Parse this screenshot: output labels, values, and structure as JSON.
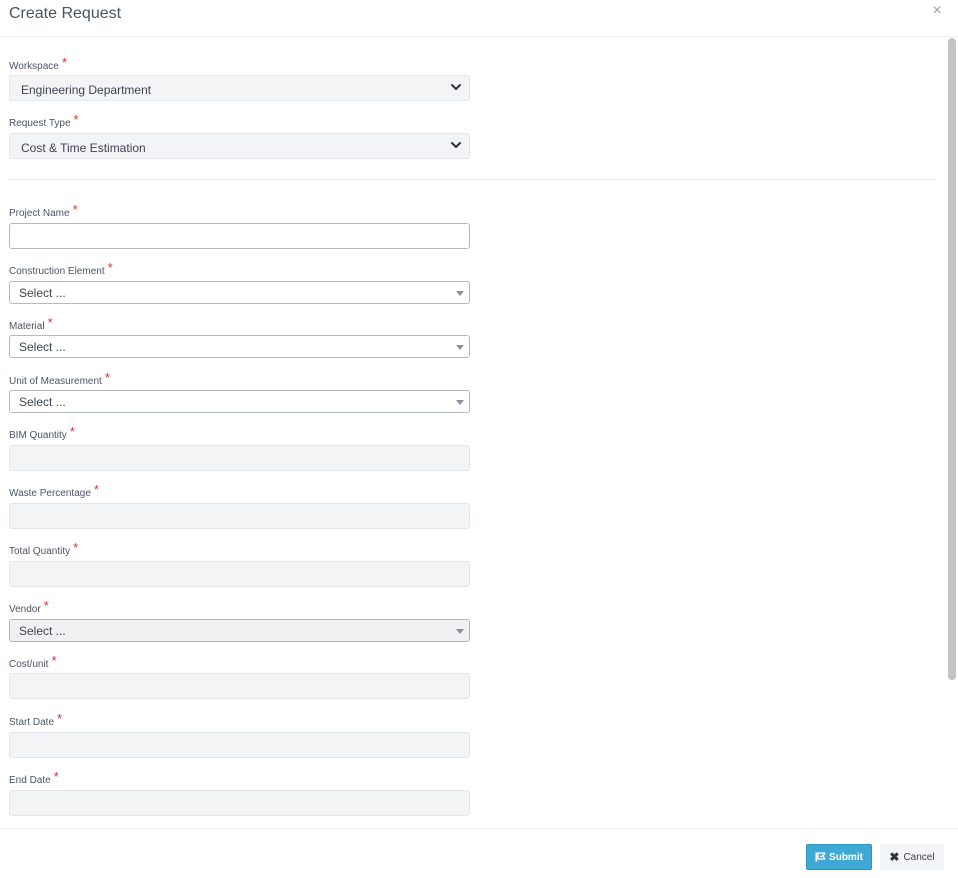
{
  "modal": {
    "title": "Create Request",
    "close_glyph": "×"
  },
  "required_mark": "*",
  "workspace": {
    "label": "Workspace",
    "value": "Engineering Department"
  },
  "request_type": {
    "label": "Request Type",
    "value": "Cost & Time Estimation"
  },
  "fields": {
    "project_name": {
      "label": "Project Name",
      "value": ""
    },
    "construction_element": {
      "label": "Construction Element",
      "value": "Select ..."
    },
    "material": {
      "label": "Material",
      "value": "Select ..."
    },
    "unit_of_measurement": {
      "label": "Unit of Measurement",
      "value": "Select ..."
    },
    "bim_quantity": {
      "label": "BIM Quantity",
      "value": ""
    },
    "waste_percentage": {
      "label": "Waste Percentage",
      "value": ""
    },
    "total_quantity": {
      "label": "Total Quantity",
      "value": ""
    },
    "vendor": {
      "label": "Vendor",
      "value": "Select ..."
    },
    "cost_unit": {
      "label": "Cost/unit",
      "value": ""
    },
    "start_date": {
      "label": "Start Date",
      "value": ""
    },
    "end_date": {
      "label": "End Date",
      "value": ""
    }
  },
  "footer": {
    "submit_label": "Submit",
    "cancel_label": "Cancel"
  },
  "colors": {
    "primary": "#3fa9d6",
    "required": "#d9322e",
    "readonly_bg": "#f3f4f6"
  },
  "icons": {
    "submit": "submit-icon",
    "cancel": "close-icon",
    "dropdown": "chevron-down-icon"
  }
}
